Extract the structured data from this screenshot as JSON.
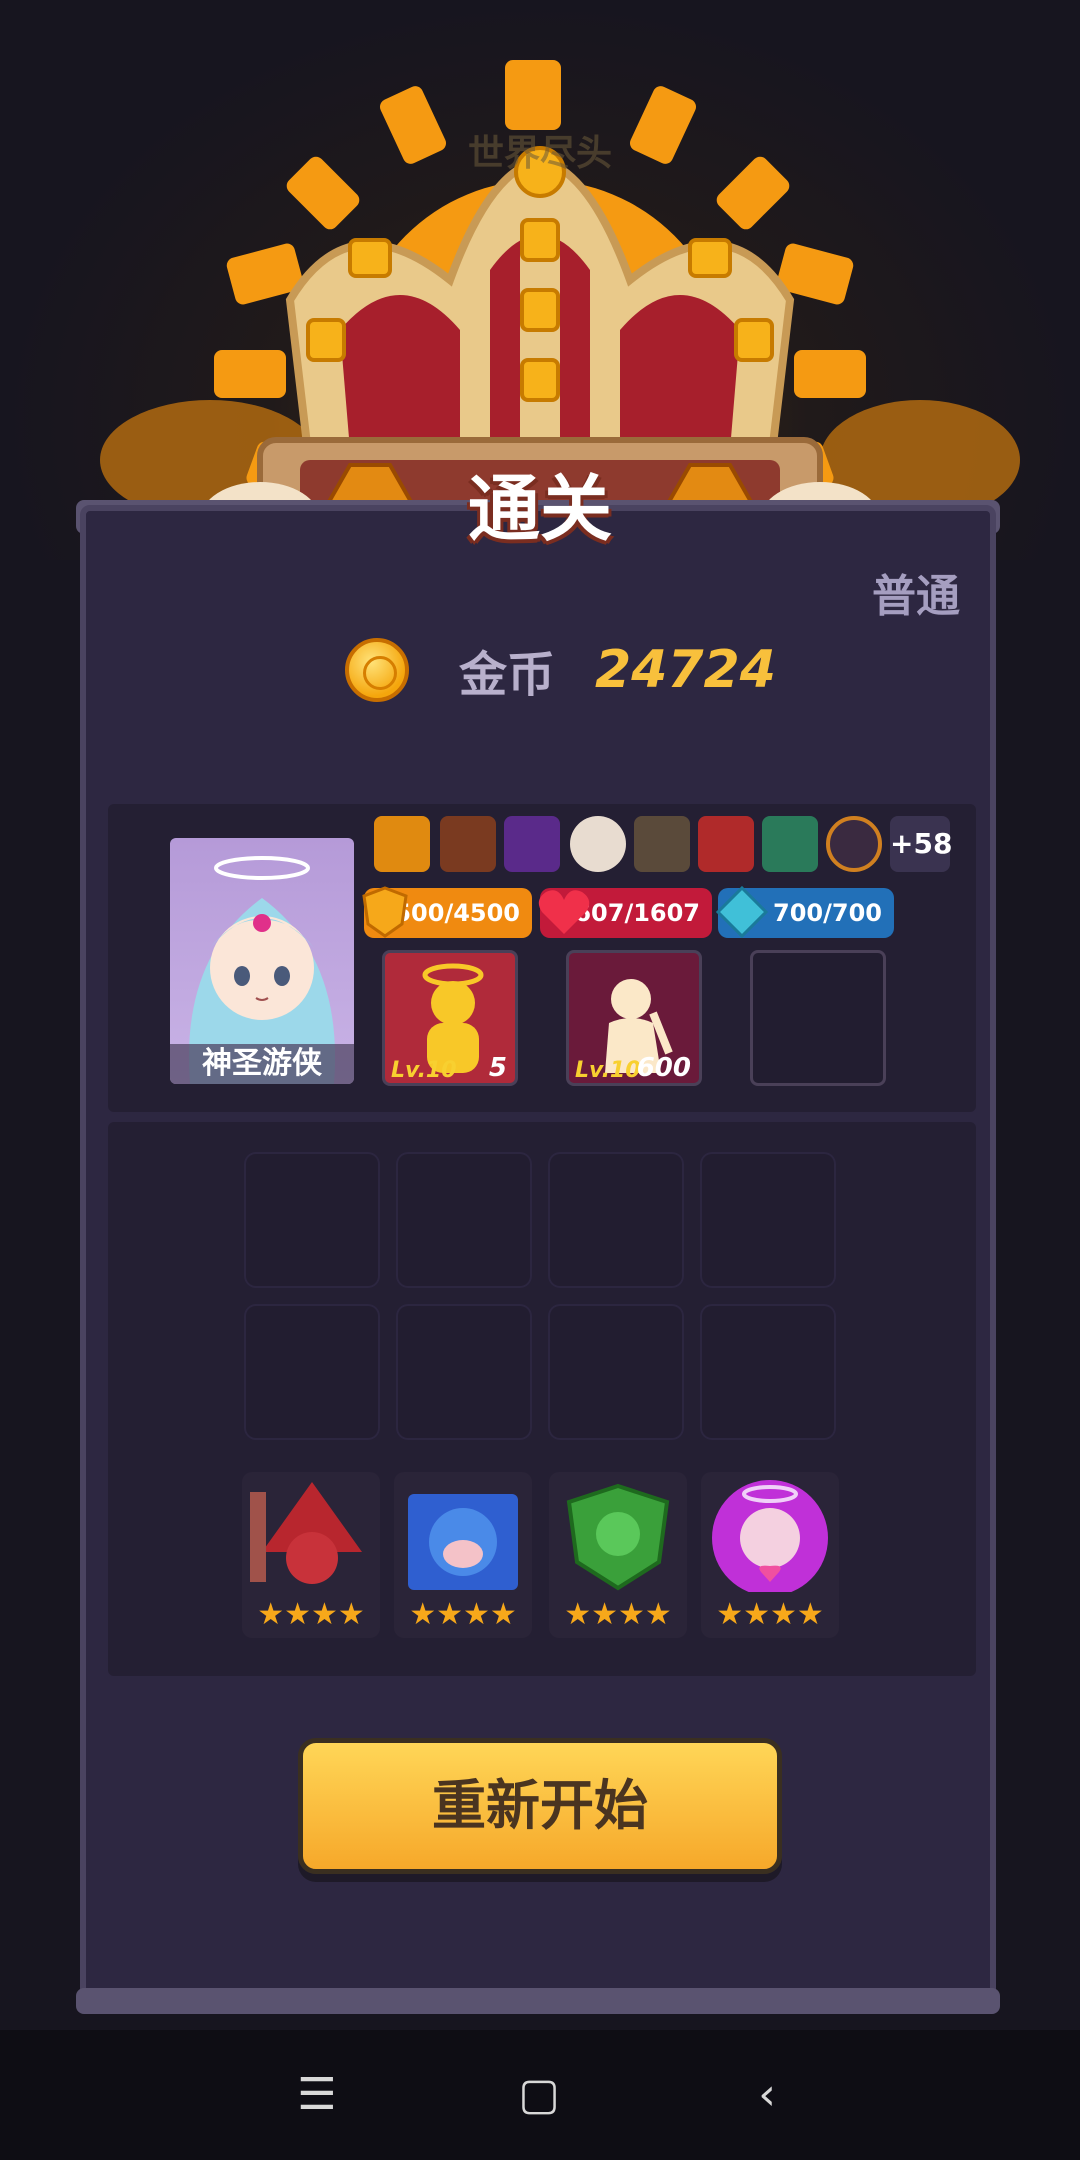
{
  "header": {
    "subtitle": "世界尽头",
    "banner": "通关",
    "difficulty": "普通"
  },
  "reward": {
    "label": "金币",
    "value": "24724",
    "icon": "coin-icon"
  },
  "hero": {
    "name": "神圣游侠",
    "relics": [
      {
        "icon": "crown-shield-icon"
      },
      {
        "icon": "book-icon"
      },
      {
        "icon": "striped-hat-icon"
      },
      {
        "icon": "compass-icon"
      },
      {
        "icon": "owl-icon"
      },
      {
        "icon": "fire-flower-icon"
      },
      {
        "icon": "cactus-icon"
      },
      {
        "icon": "heart-icon"
      }
    ],
    "relics_more": "+58",
    "stats": {
      "shield": "4500/4500",
      "hp": "1607/1607",
      "mana": "700/700"
    },
    "skills": [
      {
        "level": "Lv.10",
        "count": "5",
        "icon": "halo-figure-icon"
      },
      {
        "level": "Lv.10",
        "count": "600",
        "icon": "archer-figure-icon"
      }
    ]
  },
  "team": [
    {
      "name": "red-wizard",
      "stars": 4,
      "color": "#b8262e"
    },
    {
      "name": "blue-monkey",
      "stars": 4,
      "color": "#2f5fd0"
    },
    {
      "name": "green-shield",
      "stars": 4,
      "color": "#3aa03a"
    },
    {
      "name": "purple-angel",
      "stars": 4,
      "color": "#b02ad0"
    }
  ],
  "actions": {
    "restart": "重新开始"
  },
  "colors": {
    "panel": "#2d2741",
    "gold": "#f8c03c",
    "button": "#f6a82a"
  }
}
